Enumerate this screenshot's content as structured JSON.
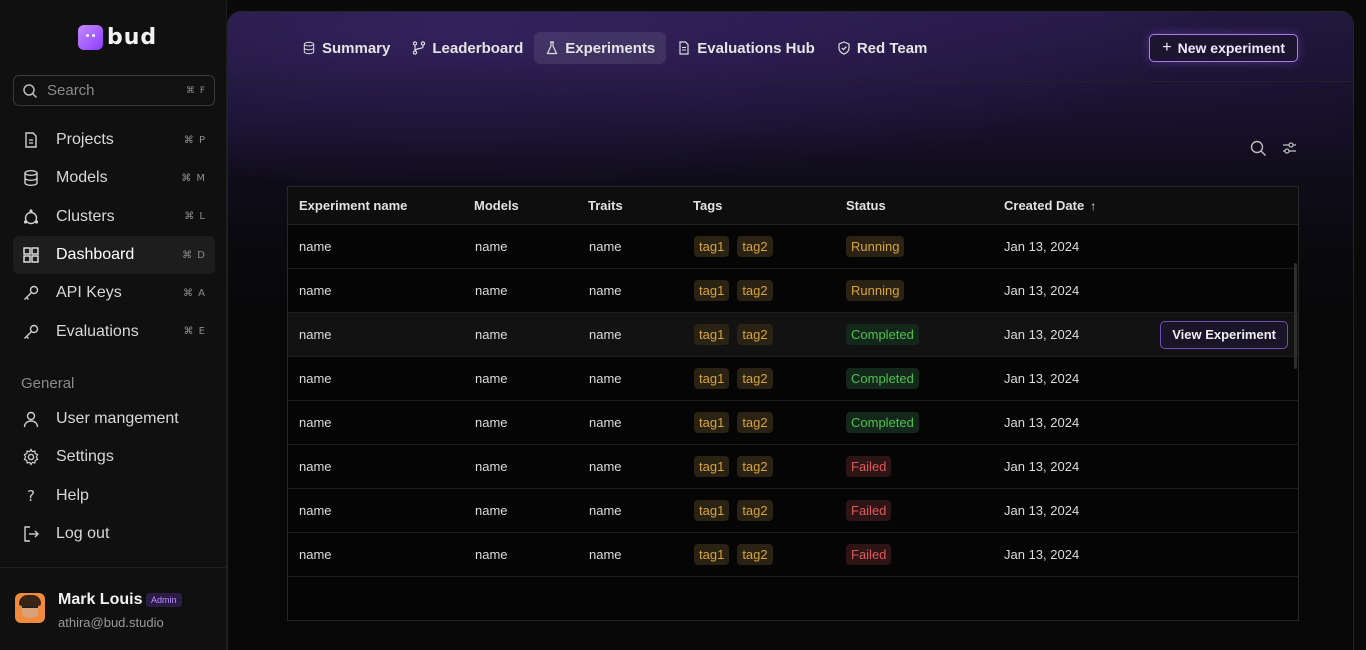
{
  "brand": {
    "logo_text": "bud",
    "accent": "#8b3dff"
  },
  "search": {
    "placeholder": "Search",
    "shortcut": "⌘ F"
  },
  "sidebar": {
    "items": [
      {
        "label": "Projects",
        "shortcut": "⌘ P",
        "icon": "file-icon"
      },
      {
        "label": "Models",
        "shortcut": "⌘ M",
        "icon": "database-icon"
      },
      {
        "label": "Clusters",
        "shortcut": "⌘ L",
        "icon": "cluster-icon"
      },
      {
        "label": "Dashboard",
        "shortcut": "⌘ D",
        "icon": "grid-icon",
        "active": true
      },
      {
        "label": "API Keys",
        "shortcut": "⌘ A",
        "icon": "key-icon"
      },
      {
        "label": "Evaluations",
        "shortcut": "⌘ E",
        "icon": "key-icon"
      }
    ],
    "general_title": "General",
    "general_items": [
      {
        "label": "User mangement",
        "icon": "user-icon"
      },
      {
        "label": "Settings",
        "icon": "gear-icon"
      },
      {
        "label": "Help",
        "icon": "question-icon"
      },
      {
        "label": "Log out",
        "icon": "logout-icon"
      }
    ]
  },
  "profile": {
    "name": "Mark Louis",
    "role": "Admin",
    "email": "athira@bud.studio"
  },
  "tabs": [
    {
      "label": "Summary",
      "icon": "database-icon"
    },
    {
      "label": "Leaderboard",
      "icon": "branch-icon"
    },
    {
      "label": "Experiments",
      "icon": "flask-icon",
      "active": true
    },
    {
      "label": "Evaluations Hub",
      "icon": "document-icon"
    },
    {
      "label": "Red Team",
      "icon": "shield-icon"
    }
  ],
  "new_experiment_label": "New experiment",
  "table": {
    "columns": [
      "Experiment name",
      "Models",
      "Traits",
      "Tags",
      "Status",
      "Created Date"
    ],
    "sort_indicator": "↑",
    "view_button_label": "View Experiment",
    "rows": [
      {
        "name": "name",
        "models": "name",
        "traits": "name",
        "tags": [
          "tag1",
          "tag2"
        ],
        "status": "Running",
        "date": "Jan 13, 2024"
      },
      {
        "name": "name",
        "models": "name",
        "traits": "name",
        "tags": [
          "tag1",
          "tag2"
        ],
        "status": "Running",
        "date": "Jan 13, 2024"
      },
      {
        "name": "name",
        "models": "name",
        "traits": "name",
        "tags": [
          "tag1",
          "tag2"
        ],
        "status": "Completed",
        "date": "Jan 13, 2024",
        "hover": true
      },
      {
        "name": "name",
        "models": "name",
        "traits": "name",
        "tags": [
          "tag1",
          "tag2"
        ],
        "status": "Completed",
        "date": "Jan 13, 2024"
      },
      {
        "name": "name",
        "models": "name",
        "traits": "name",
        "tags": [
          "tag1",
          "tag2"
        ],
        "status": "Completed",
        "date": "Jan 13, 2024"
      },
      {
        "name": "name",
        "models": "name",
        "traits": "name",
        "tags": [
          "tag1",
          "tag2"
        ],
        "status": "Failed",
        "date": "Jan 13, 2024"
      },
      {
        "name": "name",
        "models": "name",
        "traits": "name",
        "tags": [
          "tag1",
          "tag2"
        ],
        "status": "Failed",
        "date": "Jan 13, 2024"
      },
      {
        "name": "name",
        "models": "name",
        "traits": "name",
        "tags": [
          "tag1",
          "tag2"
        ],
        "status": "Failed",
        "date": "Jan 13, 2024"
      }
    ]
  },
  "status_colors": {
    "Running": "#d8a43c",
    "Completed": "#4fc24f",
    "Failed": "#e0585a"
  }
}
